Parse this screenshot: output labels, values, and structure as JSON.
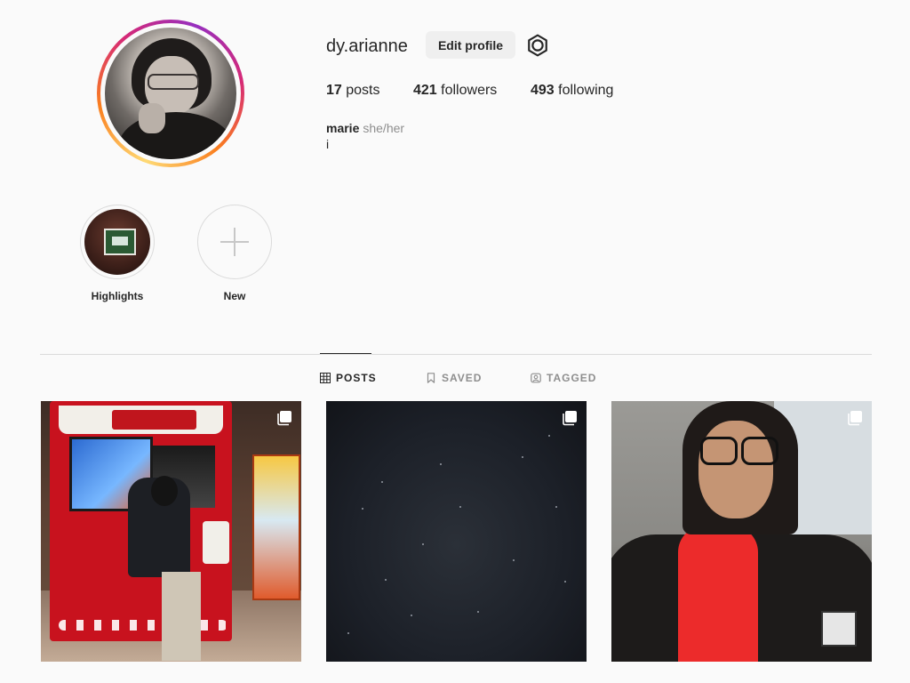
{
  "profile": {
    "username": "dy.arianne",
    "edit_button": "Edit profile",
    "stats": {
      "posts_count": "17",
      "posts_label": "posts",
      "followers_count": "421",
      "followers_label": "followers",
      "following_count": "493",
      "following_label": "following"
    },
    "bio": {
      "name": "marie",
      "pronouns": "she/her",
      "text": "i"
    }
  },
  "highlights": [
    {
      "label": "Highlights"
    },
    {
      "label": "New"
    }
  ],
  "tabs": [
    {
      "label": "POSTS",
      "icon": "grid-icon",
      "active": true
    },
    {
      "label": "SAVED",
      "icon": "bookmark-icon",
      "active": false
    },
    {
      "label": "TAGGED",
      "icon": "tagged-icon",
      "active": false
    }
  ],
  "posts": [
    {
      "subject": "arcade",
      "multiple": true
    },
    {
      "subject": "night-sky",
      "multiple": true
    },
    {
      "subject": "selfie",
      "multiple": true
    }
  ],
  "colors": {
    "background": "#fafafa",
    "text": "#262626",
    "muted": "#8e8e8e",
    "button_bg": "#efefef",
    "divider": "#dbdbdb",
    "story_ring": [
      "#feda75",
      "#fa7e1e",
      "#d62976",
      "#962fbf"
    ]
  }
}
